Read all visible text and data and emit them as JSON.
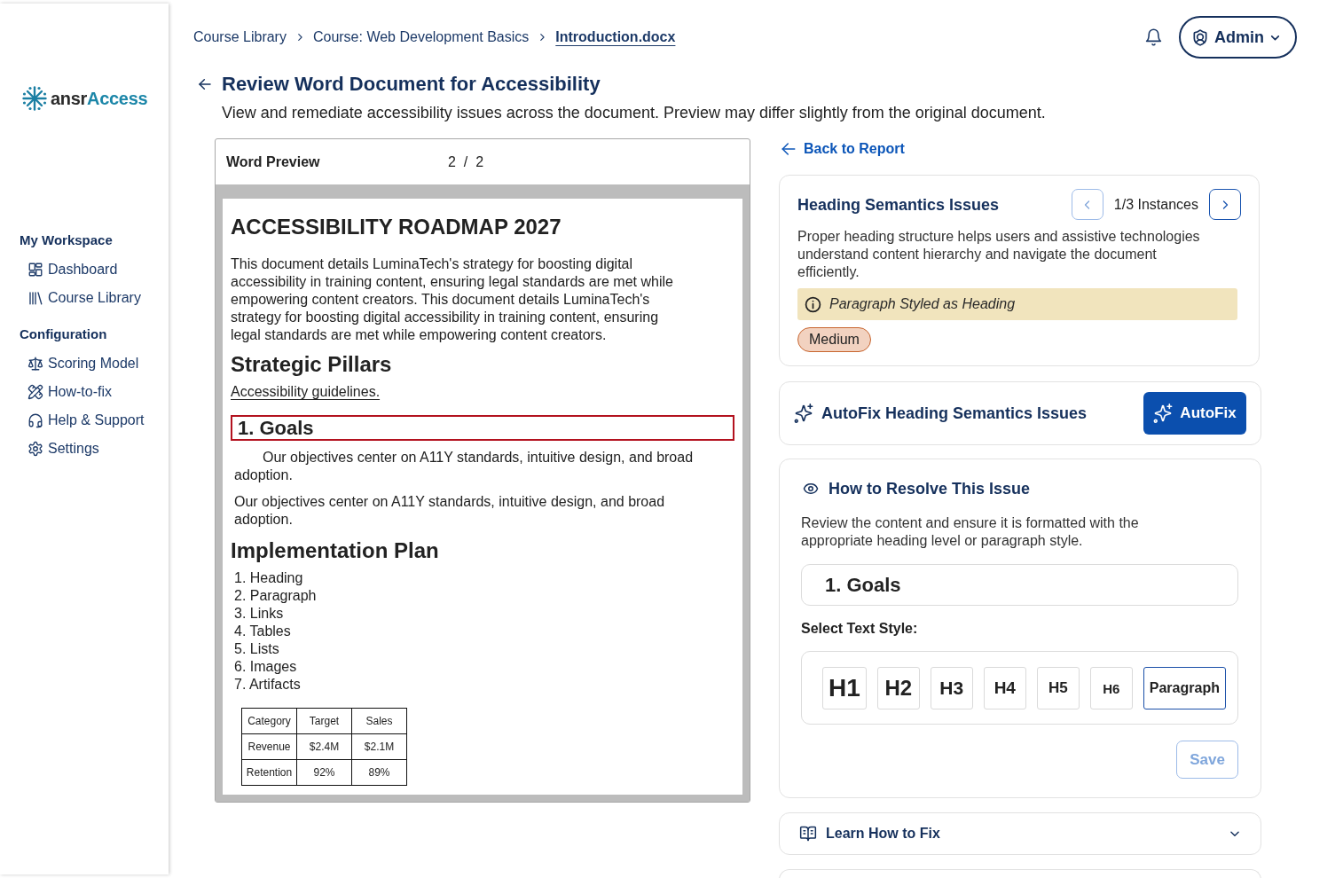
{
  "sidebar": {
    "logo": {
      "name": "ansr",
      "accent": "Access"
    },
    "sections": [
      {
        "heading": "My Workspace",
        "items": [
          {
            "label": "Dashboard"
          },
          {
            "label": "Course Library"
          }
        ]
      },
      {
        "heading": "Configuration",
        "items": [
          {
            "label": "Scoring Model"
          },
          {
            "label": "How-to-fix"
          },
          {
            "label": "Help & Support"
          },
          {
            "label": "Settings"
          }
        ]
      }
    ]
  },
  "breadcrumb": [
    {
      "label": "Course Library",
      "current": false
    },
    {
      "label": "Course: Web Development Basics",
      "current": false
    },
    {
      "label": "Introduction.docx",
      "current": true
    }
  ],
  "user_menu": {
    "label": "Admin"
  },
  "page": {
    "title": "Review Word Document for Accessibility",
    "subtitle": "View and remediate accessibility issues across the document. Preview may differ slightly from the original document."
  },
  "preview": {
    "title": "Word Preview",
    "page_counter": "2  /  2",
    "document": [
      {
        "kind": "title",
        "text": "ACCESSIBILITY ROADMAP 2027"
      },
      {
        "kind": "paragraph",
        "indented": false,
        "text": "This document details LuminaTech's strategy for boosting digital accessibility in training content, ensuring legal standards are met while empowering content creators. This document details LuminaTech's strategy for boosting digital accessibility in training content, ensuring legal standards are met while empowering content creators."
      },
      {
        "kind": "heading",
        "text": "Strategic Pillars"
      },
      {
        "kind": "link",
        "text": "Accessibility guidelines."
      },
      {
        "kind": "styled_paragraph",
        "flagged": true,
        "text": "1. Goals"
      },
      {
        "kind": "paragraph",
        "indented": true,
        "text": "Our objectives center on A11Y standards, intuitive design, and broad adoption."
      },
      {
        "kind": "paragraph",
        "indented": false,
        "text": "Our objectives center on A11Y standards, intuitive design, and broad adoption."
      },
      {
        "kind": "heading",
        "text": "Implementation Plan"
      },
      {
        "kind": "list",
        "items": [
          "1. Heading",
          "2. Paragraph",
          "3. Links",
          "4. Tables",
          "5. Lists",
          "6. Images",
          "7. Artifacts"
        ]
      },
      {
        "kind": "table",
        "rows": [
          [
            "Category",
            "Target",
            "Sales"
          ],
          [
            "Revenue",
            "$2.4M",
            "$2.1M"
          ],
          [
            "Retention",
            "92%",
            "89%"
          ]
        ]
      }
    ]
  },
  "issue_panel": {
    "back_link": "Back to Report",
    "issue": {
      "title": "Heading Semantics Issues",
      "prev_button": {
        "disabled": true
      },
      "instances": "1/3 Instances",
      "next_button": {
        "disabled": false
      },
      "description": "Proper heading structure helps users and assistive technologies understand content hierarchy and navigate the document efficiently.",
      "alert": "Paragraph Styled as Heading",
      "severity": "Medium"
    },
    "autofix": {
      "title": "AutoFix Heading Semantics Issues",
      "button": "AutoFix"
    },
    "resolve": {
      "title": "How to Resolve This Issue",
      "description": "Review the content and ensure it is formatted with the appropriate heading level or paragraph style.",
      "selected_text": "1. Goals",
      "style_label": "Select Text Style:",
      "styles": [
        {
          "label": "H1",
          "selected": false
        },
        {
          "label": "H2",
          "selected": false
        },
        {
          "label": "H3",
          "selected": false
        },
        {
          "label": "H4",
          "selected": false
        },
        {
          "label": "H5",
          "selected": false
        },
        {
          "label": "H6",
          "selected": false
        },
        {
          "label": "Paragraph",
          "selected": true
        }
      ],
      "save": {
        "label": "Save",
        "disabled": true
      }
    },
    "learn": {
      "title": "Learn How to Fix",
      "expanded": false
    }
  }
}
